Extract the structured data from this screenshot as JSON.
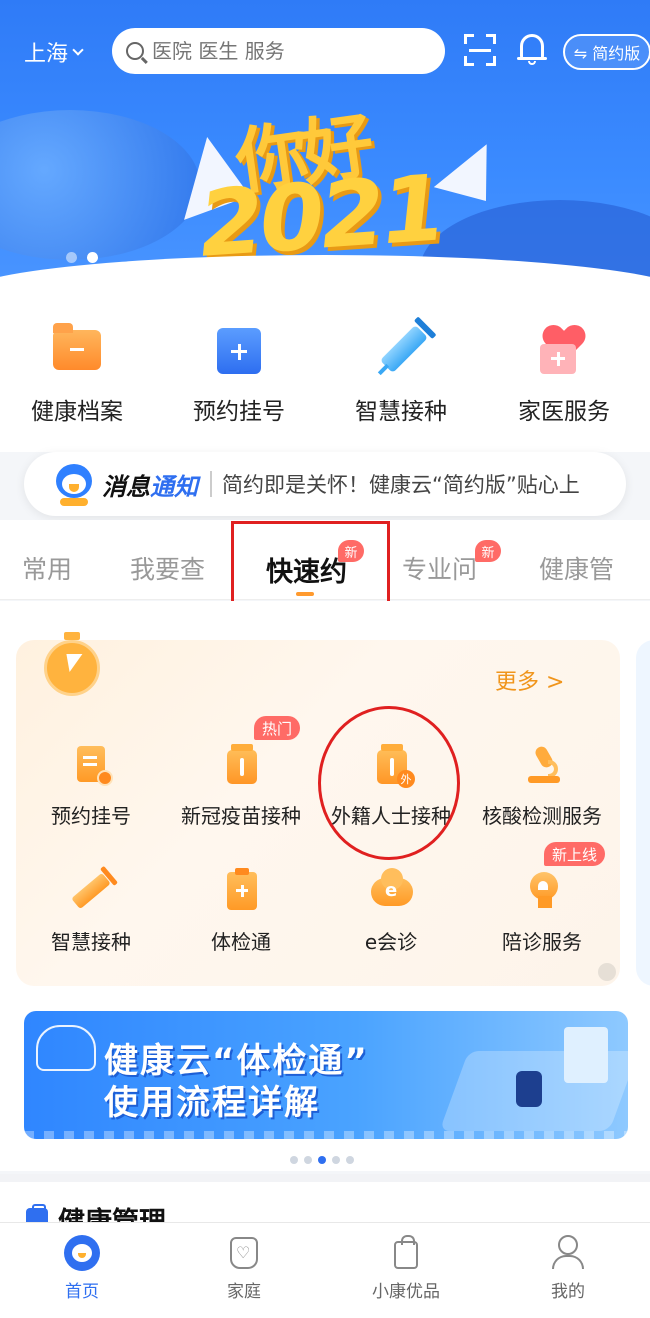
{
  "header": {
    "city": "上海",
    "search_placeholder": "医院 医生 服务",
    "simple_mode_label": "⇋ 简约版"
  },
  "banner": {
    "headline_line1": "你好",
    "headline_line2": "2021",
    "slide_count": 2,
    "active_slide": 2
  },
  "quick_entries": [
    {
      "label": "健康档案",
      "icon": "folder-icon"
    },
    {
      "label": "预约挂号",
      "icon": "booking-icon"
    },
    {
      "label": "智慧接种",
      "icon": "syringe-icon"
    },
    {
      "label": "家医服务",
      "icon": "family-doctor-icon"
    }
  ],
  "notice": {
    "title_part1": "消息",
    "title_part2": "通知",
    "text": "简约即是关怀！健康云“简约版”贴心上"
  },
  "tabs": [
    {
      "label": "常用",
      "badge": ""
    },
    {
      "label": "我要查",
      "badge": ""
    },
    {
      "label": "快速约",
      "badge": "新",
      "active": true
    },
    {
      "label": "专业问",
      "badge": "新"
    },
    {
      "label": "健康管",
      "badge": ""
    }
  ],
  "quick_appointment": {
    "more_label": "更多 >",
    "items": [
      {
        "label": "预约挂号",
        "badge": "",
        "icon": "appointment-doc-icon"
      },
      {
        "label": "新冠疫苗接种",
        "badge": "热门",
        "icon": "vaccine-jar-icon"
      },
      {
        "label": "外籍人士接种",
        "badge": "",
        "icon": "foreigner-vaccine-icon",
        "badge_glyph": "外"
      },
      {
        "label": "核酸检测服务",
        "badge": "",
        "icon": "microscope-icon"
      },
      {
        "label": "智慧接种",
        "badge": "",
        "icon": "syringe-icon"
      },
      {
        "label": "体检通",
        "badge": "",
        "icon": "clipboard-icon"
      },
      {
        "label": "e会诊",
        "badge": "",
        "icon": "cloud-icon",
        "icon_glyph": "e"
      },
      {
        "label": "陪诊服务",
        "badge": "新上线",
        "icon": "escort-icon"
      }
    ]
  },
  "promo": {
    "line1": "健康云“体检通”",
    "line2": "使用流程详解",
    "slide_count": 5,
    "active_slide": 3
  },
  "section": {
    "title": "健康管理"
  },
  "bottom_nav": [
    {
      "label": "首页",
      "active": true
    },
    {
      "label": "家庭"
    },
    {
      "label": "小康优品"
    },
    {
      "label": "我的"
    }
  ],
  "colors": {
    "brand_blue": "#2f6ff0",
    "accent_orange": "#ff9a2e",
    "badge_red": "#ff6b66",
    "annotation_red": "#e02020"
  }
}
